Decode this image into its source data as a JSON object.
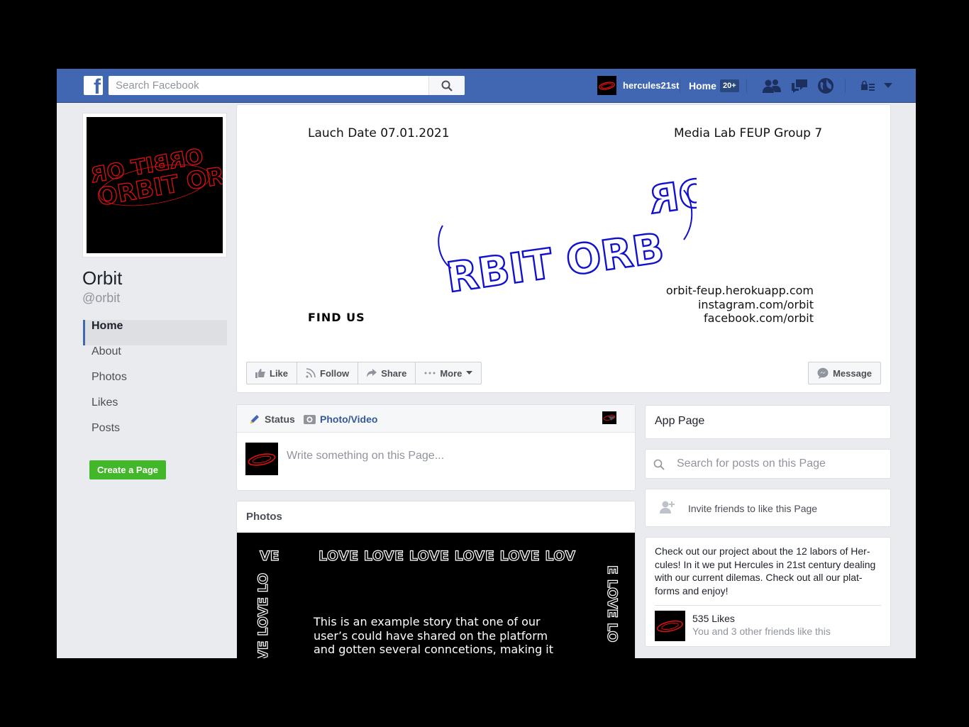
{
  "topbar": {
    "logo": "f",
    "search_placeholder": "Search Facebook",
    "username": "hercules21st",
    "home_label": "Home",
    "notification_badge": "20+"
  },
  "sidebar": {
    "page_name": "Orbit",
    "page_handle": "@orbit",
    "items": [
      {
        "label": "Home",
        "active": true
      },
      {
        "label": "About"
      },
      {
        "label": "Photos"
      },
      {
        "label": "Likes"
      },
      {
        "label": "Posts"
      }
    ],
    "create_page_label": "Create a Page"
  },
  "cover": {
    "launch_date": "Lauch Date 07.01.2021",
    "group": "Media Lab FEUP Group 7",
    "find_us": "FIND US",
    "links": [
      "orbit-feup.herokuapp.com",
      "instagram.com/orbit",
      "facebook.com/orbit"
    ],
    "logo_text": "ORBIT ORBIT ORBIT",
    "logo_color": "#1010d0",
    "profile_logo_color": "#e01010"
  },
  "actions": {
    "like": "Like",
    "follow": "Follow",
    "share": "Share",
    "more": "More",
    "message": "Message"
  },
  "composer": {
    "status_tab": "Status",
    "photo_tab": "Photo/Video",
    "placeholder": "Write something on this Page..."
  },
  "photos": {
    "title": "Photos",
    "love_top": "LOVE LOVE LOVE LOVE LOVE LOV",
    "love_topleft": "VE",
    "love_left": "VE LOVE LO",
    "love_right": "E LOVE LO",
    "story": "This is an example story that one of our user’s could have shared on the platform and gotten several conncetions, making it"
  },
  "right": {
    "app_page": "App Page",
    "search_placeholder": "Search for posts on this Page",
    "invite": "Invite friends to like this Page",
    "about": "Check out our project about the 12 labors of Her-cules! In it we put Hercules in 21st century dealing with our current dilemas. Check out all our plat-forms and enjoy!",
    "likes_count": "535 Likes",
    "likes_friends": "You and 3 other friends like this"
  }
}
